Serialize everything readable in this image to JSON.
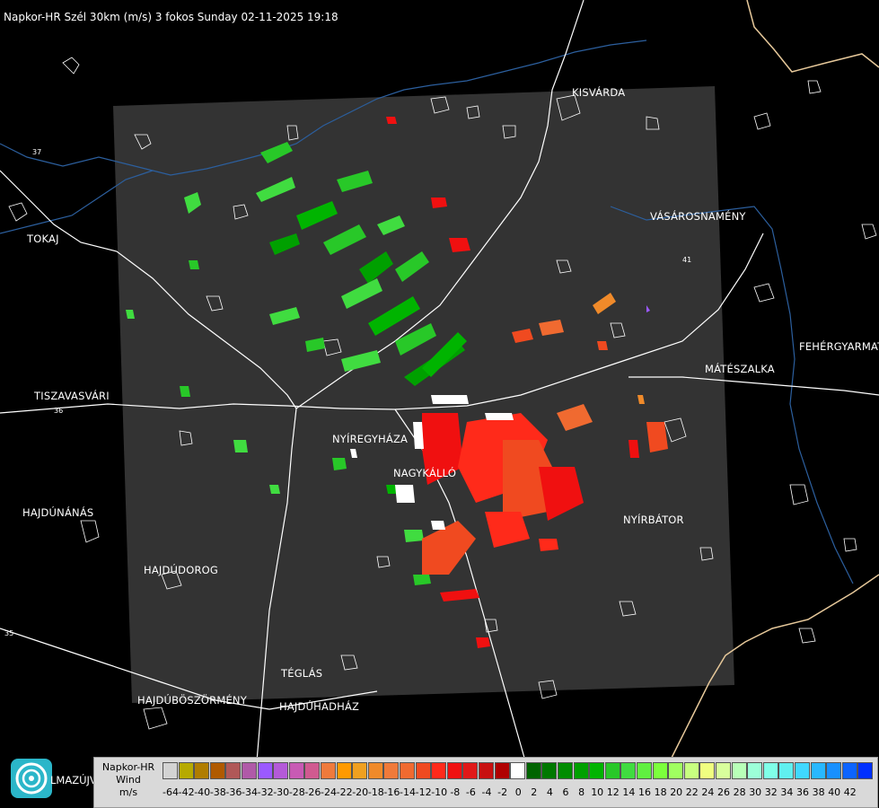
{
  "title": "Napkor-HR Szél 30km (m/s) 3 fokos Sunday 02-11-2025 19:18",
  "cities": [
    {
      "name": "KISVÁRDA",
      "id": "kisvarda"
    },
    {
      "name": "TOKAJ",
      "id": "tokaj"
    },
    {
      "name": "VÁSÁROSNAMÉNY",
      "id": "vasarosnameny"
    },
    {
      "name": "FEHÉRGYARMAT",
      "id": "fehergyarmat"
    },
    {
      "name": "MÁTÉSZALKA",
      "id": "mateszalka"
    },
    {
      "name": "TISZAVASVÁRI",
      "id": "tiszavasvari"
    },
    {
      "name": "NYÍREGYHÁZA",
      "id": "nyiregyhaza"
    },
    {
      "name": "NAGYKÁLLÓ",
      "id": "nagykallo"
    },
    {
      "name": "HAJDÚNÁNÁS",
      "id": "hajdunanas"
    },
    {
      "name": "NYÍRBÁTOR",
      "id": "nyirbator"
    },
    {
      "name": "HAJDÚDOROG",
      "id": "hajdudorog"
    },
    {
      "name": "TÉGLÁS",
      "id": "teglas"
    },
    {
      "name": "HAJDÚBÖSZÖRMÉNY",
      "id": "hajduboszormeny"
    },
    {
      "name": "HAJDÚHADHÁZ",
      "id": "hajduhadhaz"
    }
  ],
  "road_numbers": [
    "37",
    "36",
    "35",
    "41",
    "26"
  ],
  "logo_text": "LMAZÚJVÁR",
  "legend": {
    "label_line1": "Napkor-HR",
    "label_line2": "Wind",
    "label_line3": "m/s",
    "colors": [
      "#d3d3d3",
      "#b6aa00",
      "#b07d00",
      "#b05a00",
      "#b05858",
      "#b05aa8",
      "#9b59ff",
      "#b45ad8",
      "#c85ab4",
      "#d05a90",
      "#ef7a3c",
      "#ff9a00",
      "#f0a020",
      "#f08a2a",
      "#f07a3a",
      "#f06a30",
      "#f04a20",
      "#ff2a1a",
      "#f01010",
      "#e01818",
      "#c81010",
      "#b00000",
      "#ffffff",
      "#006400",
      "#007800",
      "#008c00",
      "#00a000",
      "#00b400",
      "#28c828",
      "#40dc40",
      "#60f040",
      "#7cff3c",
      "#a0ff60",
      "#c8ff80",
      "#f0ff80",
      "#d8ff9c",
      "#b8ffb8",
      "#9cffd8",
      "#80ffe8",
      "#60f0f0",
      "#40d8ff",
      "#28b8ff",
      "#1890ff",
      "#0c64ff",
      "#0030ff"
    ],
    "ticks": [
      "-64",
      "-42",
      "-40",
      "-38",
      "-36",
      "-34",
      "-32",
      "-30",
      "-28",
      "-26",
      "-24",
      "-22",
      "-20",
      "-18",
      "-16",
      "-14",
      "-12",
      "-10",
      "-8",
      "-6",
      "-4",
      "-2",
      "0",
      "2",
      "4",
      "6",
      "8",
      "10",
      "12",
      "14",
      "16",
      "18",
      "20",
      "22",
      "24",
      "26",
      "28",
      "30",
      "32",
      "34",
      "36",
      "38",
      "40",
      "42"
    ]
  }
}
